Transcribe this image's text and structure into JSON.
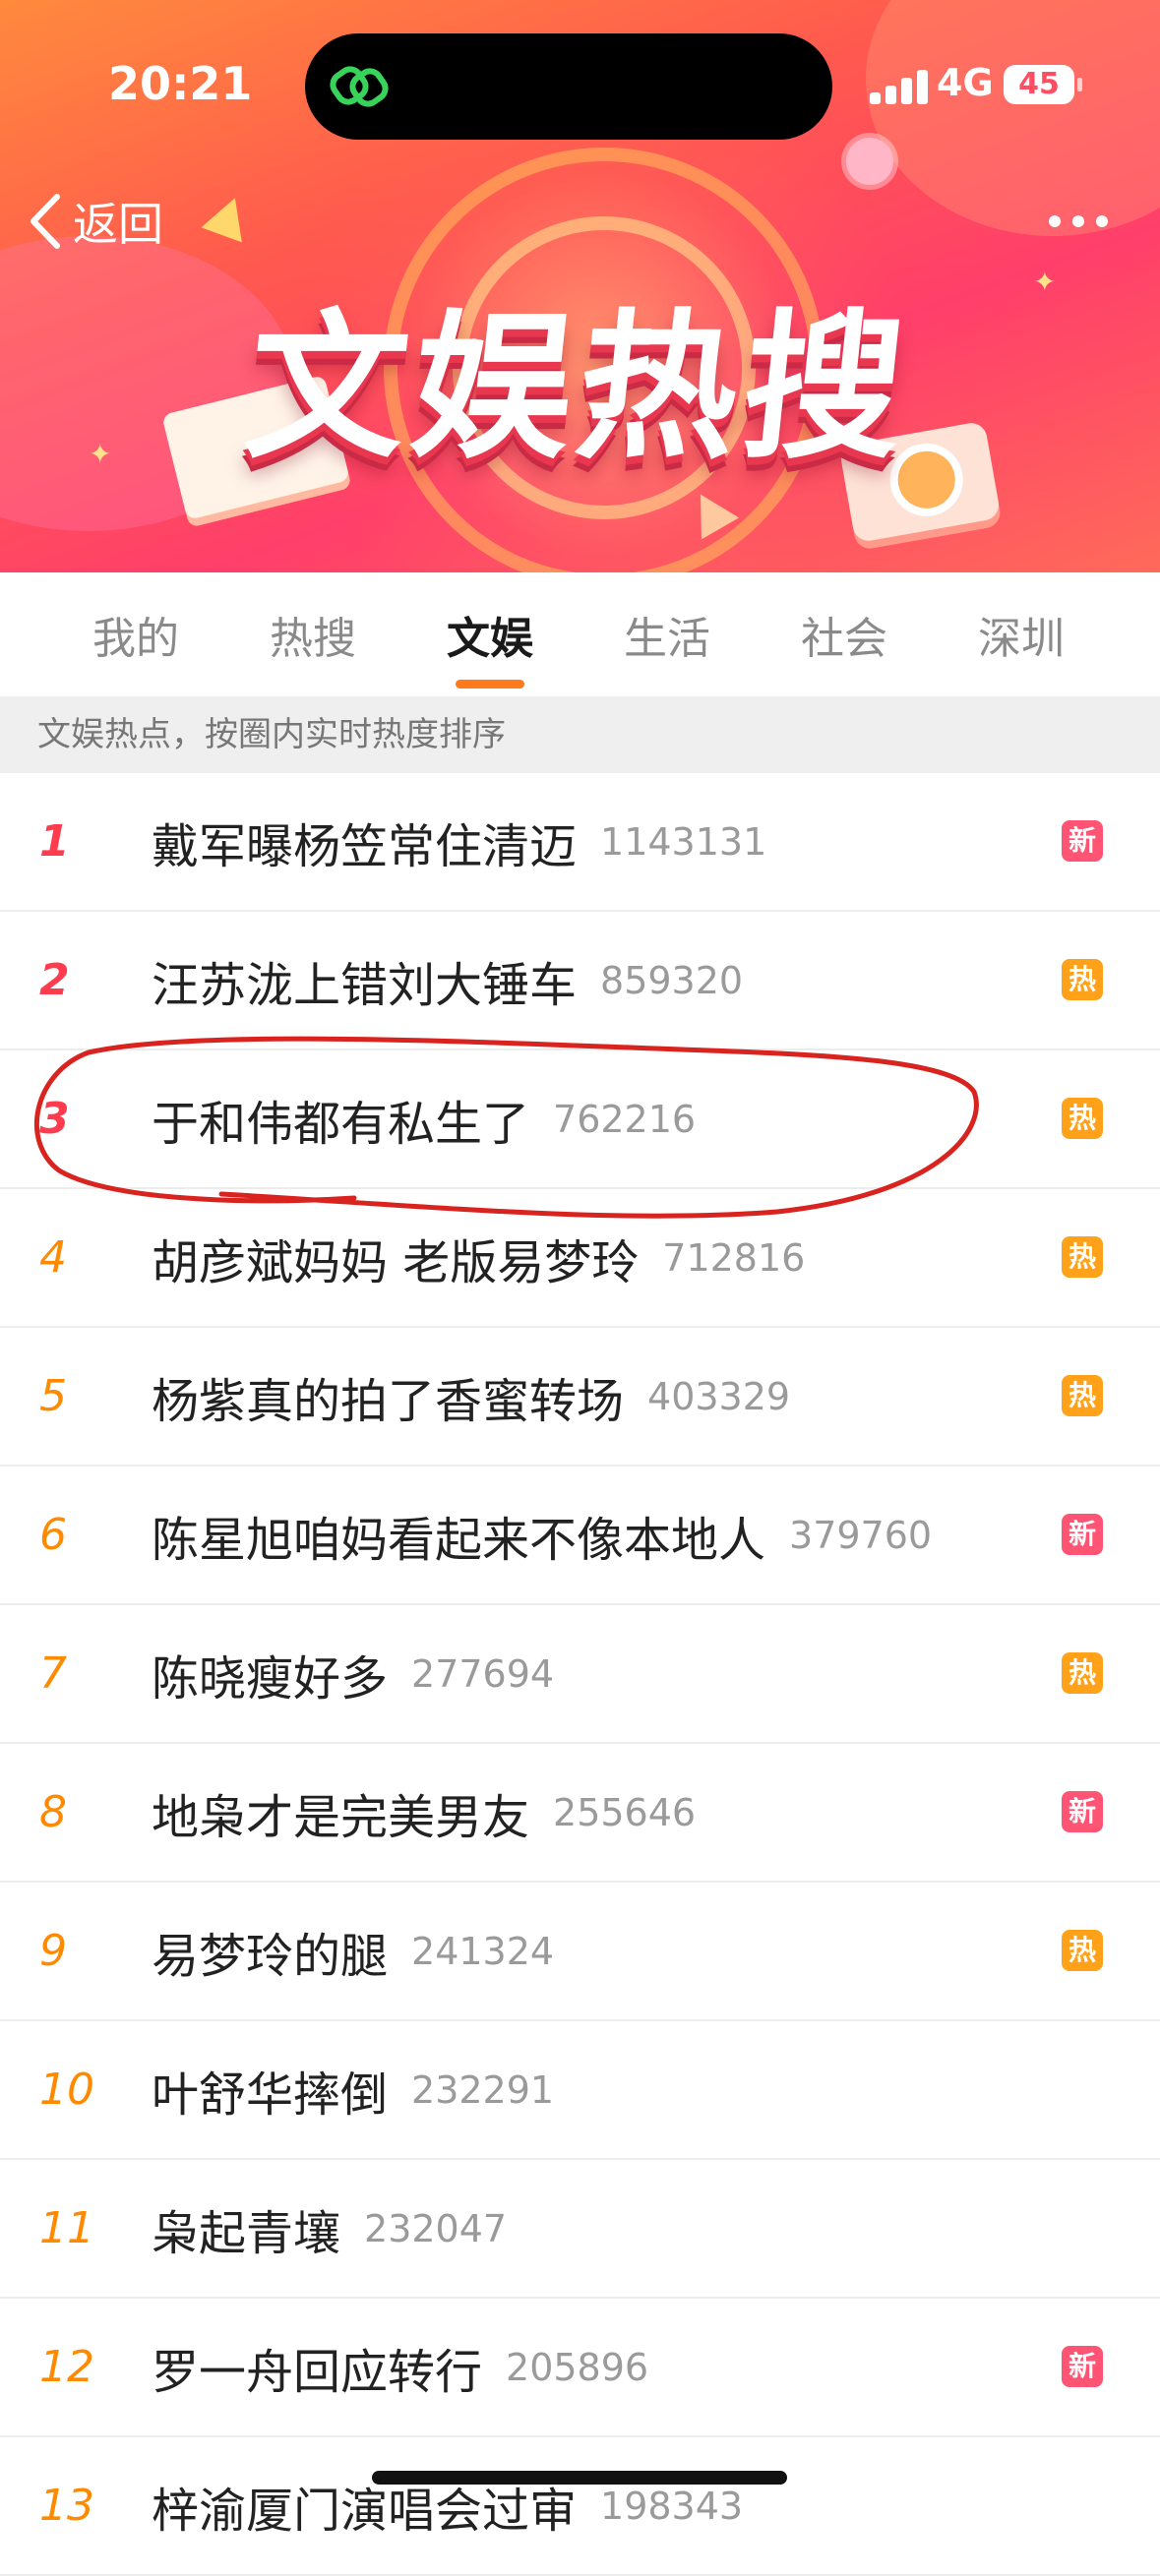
{
  "status_bar": {
    "time": "20:21",
    "network": "4G",
    "battery": "45"
  },
  "header": {
    "back_label": "返回",
    "banner_title": "文娱热搜"
  },
  "tabs": [
    {
      "label": "我的",
      "active": false
    },
    {
      "label": "热搜",
      "active": false
    },
    {
      "label": "文娱",
      "active": true
    },
    {
      "label": "生活",
      "active": false
    },
    {
      "label": "社会",
      "active": false
    },
    {
      "label": "深圳",
      "active": false
    }
  ],
  "subheader": "文娱热点，按圈内实时热度排序",
  "list": [
    {
      "rank": "1",
      "title": "戴军曝杨笠常住清迈",
      "count": "1143131",
      "badge": "新",
      "badge_type": "new"
    },
    {
      "rank": "2",
      "title": "汪苏泷上错刘大锤车",
      "count": "859320",
      "badge": "热",
      "badge_type": "hot"
    },
    {
      "rank": "3",
      "title": "于和伟都有私生了",
      "count": "762216",
      "badge": "热",
      "badge_type": "hot"
    },
    {
      "rank": "4",
      "title": "胡彦斌妈妈 老版易梦玲",
      "count": "712816",
      "badge": "热",
      "badge_type": "hot"
    },
    {
      "rank": "5",
      "title": "杨紫真的拍了香蜜转场",
      "count": "403329",
      "badge": "热",
      "badge_type": "hot"
    },
    {
      "rank": "6",
      "title": "陈星旭咱妈看起来不像本地人",
      "count": "379760",
      "badge": "新",
      "badge_type": "new"
    },
    {
      "rank": "7",
      "title": "陈晓瘦好多",
      "count": "277694",
      "badge": "热",
      "badge_type": "hot"
    },
    {
      "rank": "8",
      "title": "地枭才是完美男友",
      "count": "255646",
      "badge": "新",
      "badge_type": "new"
    },
    {
      "rank": "9",
      "title": "易梦玲的腿",
      "count": "241324",
      "badge": "热",
      "badge_type": "hot"
    },
    {
      "rank": "10",
      "title": "叶舒华摔倒",
      "count": "232291",
      "badge": "",
      "badge_type": ""
    },
    {
      "rank": "11",
      "title": "枭起青壤",
      "count": "232047",
      "badge": "",
      "badge_type": ""
    },
    {
      "rank": "12",
      "title": "罗一舟回应转行",
      "count": "205896",
      "badge": "新",
      "badge_type": "new"
    },
    {
      "rank": "13",
      "title": "梓渝厦门演唱会过审",
      "count": "198343",
      "badge": "",
      "badge_type": ""
    }
  ],
  "colors": {
    "accent": "#ff7a1a",
    "rank_top": "#ff3b4e",
    "rank_other": "#ff8a00",
    "badge_new": "#ff5473",
    "badge_hot": "#ffa21a",
    "annotation": "#d8231f"
  },
  "icons": {
    "back": "chevron-left-icon",
    "more": "more-dots-icon",
    "island_app": "link-icon"
  }
}
